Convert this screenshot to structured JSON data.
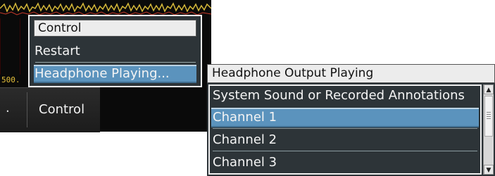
{
  "background": {
    "scale_label": "500.",
    "bottom_tab_separator": ".",
    "bottom_tab_label": "Control"
  },
  "menu": {
    "title": "Control",
    "items": [
      {
        "label": "Restart"
      },
      {
        "label": "Headphone Playing...",
        "selected": true
      }
    ]
  },
  "submenu": {
    "title": "Headphone Output Playing",
    "options": [
      {
        "label": "System Sound or Recorded Annotations"
      },
      {
        "label": "Channel 1",
        "selected": true
      },
      {
        "label": "Channel 2"
      },
      {
        "label": "Channel 3"
      }
    ],
    "scroll": {
      "up_icon": "scroll-up-arrow-icon",
      "down_icon": "scroll-down-arrow-icon"
    }
  },
  "colors": {
    "menu_bg": "#2d3438",
    "highlight": "#5b93bd",
    "title_bg": "#ececec",
    "scale_label": "#e6c13a"
  }
}
